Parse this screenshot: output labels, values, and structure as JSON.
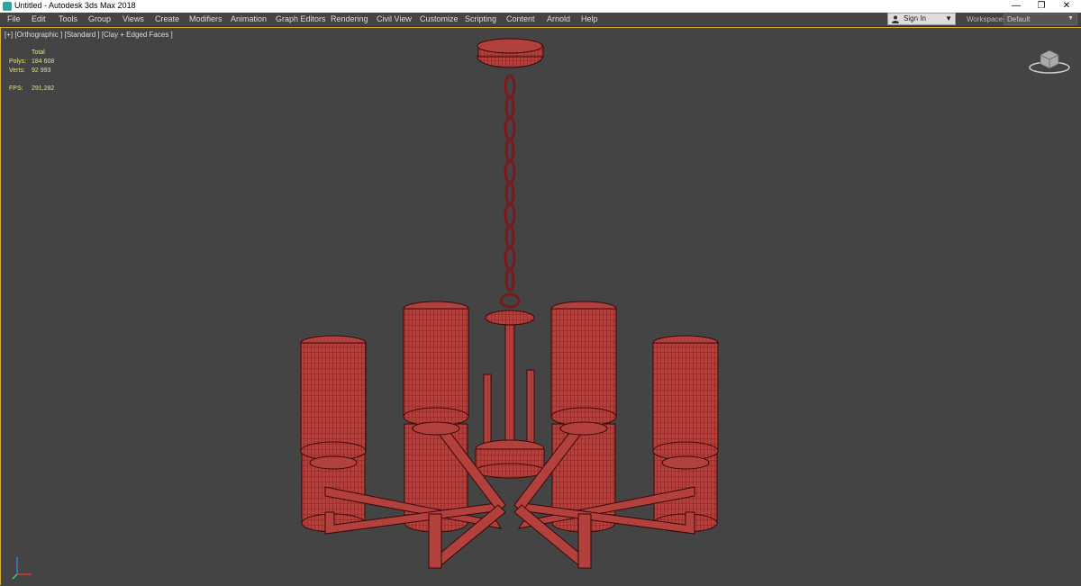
{
  "window": {
    "title": "Untitled - Autodesk 3ds Max 2018"
  },
  "menu": [
    "File",
    "Edit",
    "Tools",
    "Group",
    "Views",
    "Create",
    "Modifiers",
    "Animation",
    "Graph Editors",
    "Rendering",
    "Civil View",
    "Customize",
    "Scripting",
    "Content",
    "Arnold",
    "Help"
  ],
  "account": {
    "signin_label": "Sign In"
  },
  "workspaces": {
    "label": "Workspaces:",
    "value": "Default"
  },
  "viewport": {
    "label": "[+] [Orthographic ] [Standard ] [Clay + Edged Faces ]",
    "stats": {
      "total_label": "Total",
      "polys_label": "Polys:",
      "polys_value": "184 608",
      "verts_label": "Verts:",
      "verts_value": "92 993",
      "fps_label": "FPS:",
      "fps_value": "291,282"
    }
  },
  "colors": {
    "model": "#b2403d",
    "wire": "#5a1010",
    "stats_text": "#e8e84a",
    "viewport_bg": "#444444",
    "active_border": "#d8b03a"
  }
}
